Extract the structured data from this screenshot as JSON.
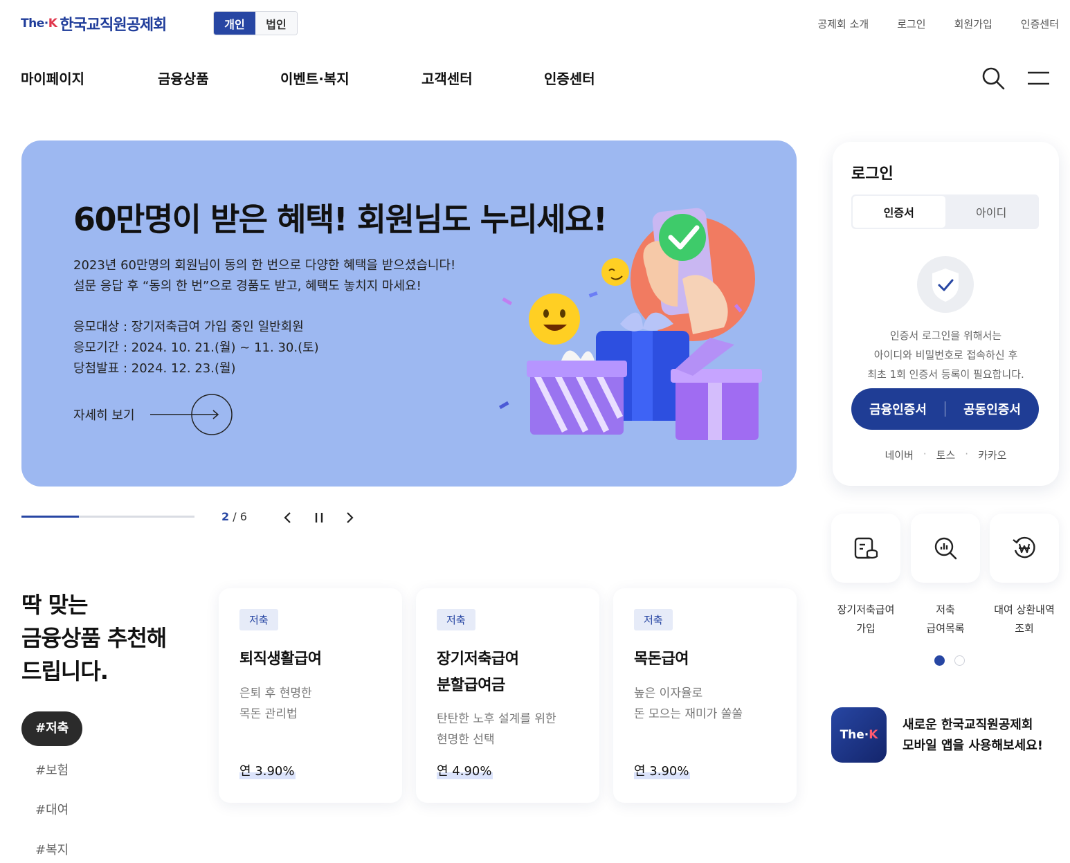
{
  "header": {
    "logo_prefix": "The·",
    "logo_k": "K",
    "logo_name": "한국교직원공제회",
    "member_types": [
      "개인",
      "법인"
    ],
    "util_nav": [
      "공제회 소개",
      "로그인",
      "회원가입",
      "인증센터"
    ],
    "gnb": [
      "마이페이지",
      "금융상품",
      "이벤트·복지",
      "고객센터",
      "인증센터"
    ]
  },
  "hero": {
    "title": "60만명이 받은 혜택! 회원님도 누리세요!",
    "desc_1": "2023년 60만명의 회원님이 동의 한 번으로 다양한 혜택을 받으셨습니다!",
    "desc_2": "설문 응답 후 “동의 한 번”으로 경품도 받고, 혜택도 놓치지 마세요!",
    "info_1": "응모대상 : 장기저축급여 가입 중인 일반회원",
    "info_2": "응모기간 : 2024. 10. 21.(월) ~ 11. 30.(토)",
    "info_3": "당첨발표 : 2024. 12. 23.(월)",
    "more_label": "자세히 보기"
  },
  "slider": {
    "current": "2",
    "separator": " / ",
    "total": "6",
    "progress": 0.333
  },
  "login": {
    "title": "로그인",
    "tabs": [
      "인증서",
      "아이디"
    ],
    "msg_1": "인증서 로그인을 위해서는",
    "msg_2": "아이디와 비밀번호로 접속하신 후",
    "msg_3": "최초 1회 인증서 등록이 필요합니다.",
    "cert_buttons": [
      "금융인증서",
      "공동인증서"
    ],
    "social": [
      "네이버",
      "토스",
      "카카오"
    ],
    "social_sep": "·"
  },
  "quick_menu": [
    {
      "icon": "document-coin-icon",
      "line1": "장기저축급여",
      "line2": "가입"
    },
    {
      "icon": "search-chart-icon",
      "line1": "저축",
      "line2": "급여목록"
    },
    {
      "icon": "won-history-icon",
      "line1": "대여 상환내역",
      "line2": "조회"
    }
  ],
  "app_promo": {
    "icon_prefix": "The·",
    "icon_k": "K",
    "line1": "새로운 한국교직원공제회",
    "line2": "모바일 앱을 사용해보세요!"
  },
  "recommend": {
    "title_1": "딱 맞는",
    "title_2": "금융상품 추천해",
    "title_3": "드립니다.",
    "tags": [
      "#저축",
      "#보험",
      "#대여",
      "#복지"
    ],
    "cards": [
      {
        "badge": "저축",
        "title_1": "퇴직생활급여",
        "title_2": "",
        "sub_1": "은퇴 후 현명한",
        "sub_2": "목돈 관리법",
        "rate": "연 3.90%"
      },
      {
        "badge": "저축",
        "title_1": "장기저축급여",
        "title_2": "분할급여금",
        "sub_1": "탄탄한 노후 설계를 위한",
        "sub_2": "현명한 선택",
        "rate": "연 4.90%"
      },
      {
        "badge": "저축",
        "title_1": "목돈급여",
        "title_2": "",
        "sub_1": "높은 이자율로",
        "sub_2": "돈 모으는 재미가 쏠쏠",
        "rate": "연 3.90%"
      }
    ]
  },
  "colors": {
    "brand": "#2746a3",
    "hero_bg": "#9db8f1",
    "cert_button": "#1f3d95"
  }
}
